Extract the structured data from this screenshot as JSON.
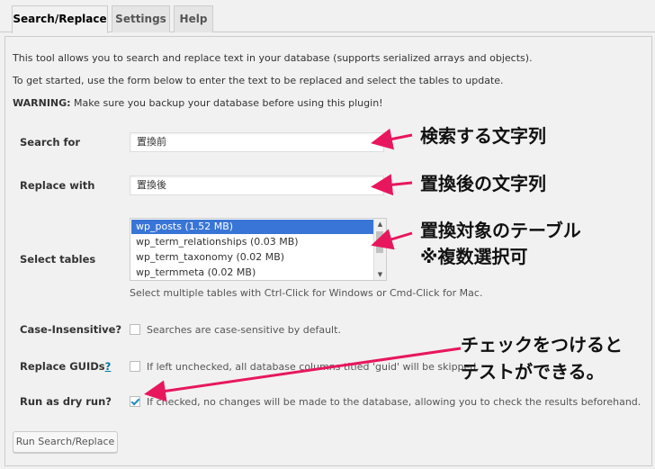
{
  "tabs": [
    {
      "label": "Search/Replace",
      "active": true
    },
    {
      "label": "Settings",
      "active": false
    },
    {
      "label": "Help",
      "active": false
    }
  ],
  "intro": {
    "line1": "This tool allows you to search and replace text in your database (supports serialized arrays and objects).",
    "line2": "To get started, use the form below to enter the text to be replaced and select the tables to update.",
    "warning_label": "WARNING:",
    "warning_text": " Make sure you backup your database before using this plugin!"
  },
  "form": {
    "search_label": "Search for",
    "search_value": "置換前",
    "replace_label": "Replace with",
    "replace_value": "置換後",
    "tables_label": "Select tables",
    "tables": [
      "wp_posts (1.52 MB)",
      "wp_term_relationships (0.03 MB)",
      "wp_term_taxonomy (0.02 MB)",
      "wp_termmeta (0.02 MB)"
    ],
    "tables_selected": "wp_posts (1.52 MB)",
    "tables_hint": "Select multiple tables with Ctrl-Click for Windows or Cmd-Click for Mac.",
    "case_label": "Case-Insensitive?",
    "case_desc": "Searches are case-sensitive by default.",
    "guids_label": "Replace GUIDs",
    "guids_help": "?",
    "guids_desc": "If left unchecked, all database columns titled 'guid' will be skipped.",
    "dry_label": "Run as dry run?",
    "dry_desc": "If checked, no changes will be made to the database, allowing you to check the results beforehand.",
    "submit_label": "Run Search/Replace"
  },
  "annotations": {
    "search": "検索する文字列",
    "replace": "置換後の文字列",
    "tables_1": "置換対象のテーブル",
    "tables_2": "※複数選択可",
    "dry_1": "チェックをつけると",
    "dry_2": "テストができる。"
  },
  "colors": {
    "annotation_arrow": "#e8175d",
    "selected_option": "#3875d7",
    "link": "#0073aa"
  }
}
